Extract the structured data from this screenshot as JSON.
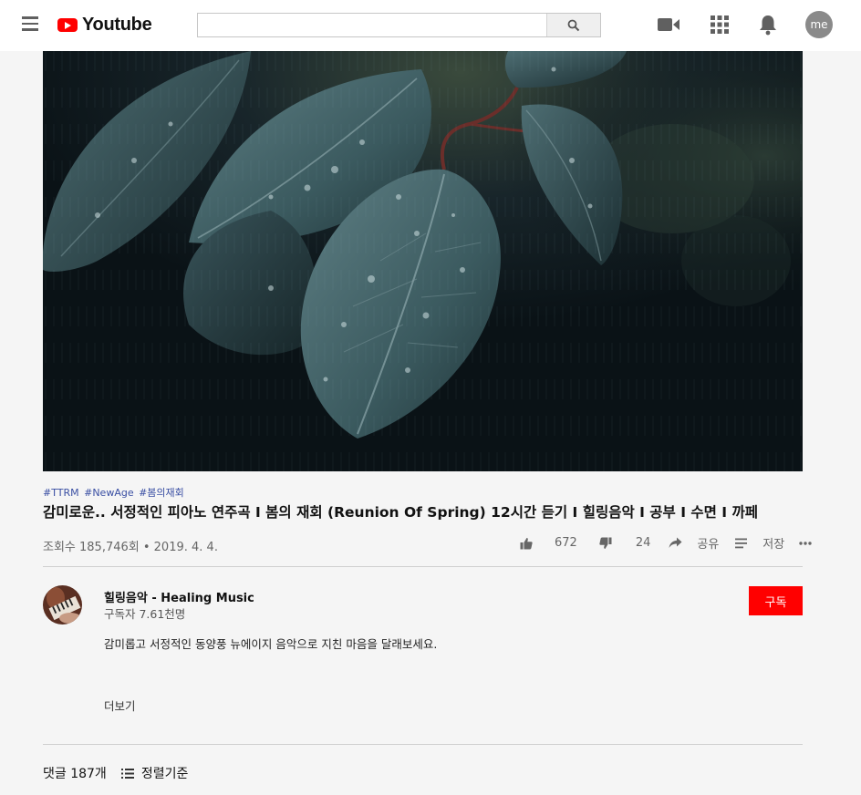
{
  "header": {
    "logo_text": "Youtube",
    "search": {
      "value": "",
      "placeholder": ""
    },
    "avatar_label": "me"
  },
  "video": {
    "hashtags": [
      "#TTRM",
      "#NewAge",
      "#봄의재회"
    ],
    "title": "감미로운.. 서정적인 피아노 연주곡 I 봄의 재회 (Reunion Of Spring) 12시간 듣기 I 힐링음악 I 공부 I 수면 I 까페",
    "meta": "조회수 185,746회 • 2019. 4. 4.",
    "likes": "672",
    "dislikes": "24",
    "share_label": "공유",
    "save_label": "저장"
  },
  "channel": {
    "name": "힐링음악 - Healing Music",
    "subscribers": "구독자 7.61천명",
    "subscribe_label": "구독",
    "description": "감미롭고 서정적인 동양풍 뉴에이지 음악으로 지친 마음을 달래보세요.",
    "more_label": "더보기"
  },
  "comments": {
    "count_label": "댓글 187개",
    "sort_label": "정렬기준"
  },
  "colors": {
    "brand": "#ff0000",
    "hashtag": "#3a4fa3",
    "background": "#f5f5f5"
  }
}
